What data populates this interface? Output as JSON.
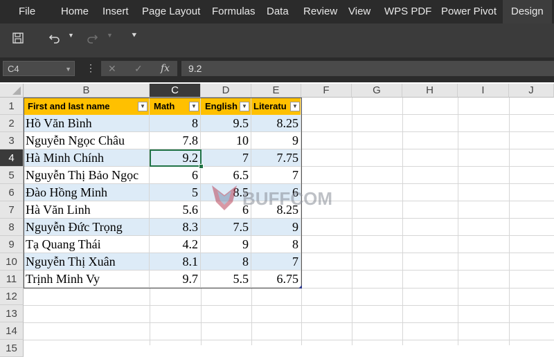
{
  "ribbon": {
    "tabs": [
      "File",
      "Home",
      "Insert",
      "Page Layout",
      "Formulas",
      "Data",
      "Review",
      "View",
      "WPS PDF",
      "Power Pivot",
      "Design"
    ],
    "active_tab": "Design"
  },
  "quick_access": {
    "icons": [
      "save-icon",
      "undo-icon",
      "redo-icon",
      "customize-icon"
    ]
  },
  "formula_bar": {
    "name_box": "C4",
    "fx_label": "fx",
    "value": "9.2"
  },
  "sheet": {
    "columns": [
      "B",
      "C",
      "D",
      "E",
      "F",
      "G",
      "H",
      "I",
      "J"
    ],
    "selected_column": "C",
    "rows": [
      "1",
      "2",
      "3",
      "4",
      "5",
      "6",
      "7",
      "8",
      "9",
      "10",
      "11",
      "12",
      "13",
      "14",
      "15"
    ],
    "selected_row": "4",
    "headers": [
      "First and last name",
      "Math",
      "English",
      "Literatu"
    ],
    "data": [
      {
        "name": "Hồ Văn Bình",
        "math": "8",
        "english": "9.5",
        "lit": "8.25"
      },
      {
        "name": "Nguyễn Ngọc Châu",
        "math": "7.8",
        "english": "10",
        "lit": "9"
      },
      {
        "name": "Hà Minh Chính",
        "math": "9.2",
        "english": "7",
        "lit": "7.75"
      },
      {
        "name": "Nguyễn Thị Bảo Ngọc",
        "math": "6",
        "english": "6.5",
        "lit": "7"
      },
      {
        "name": "Đào Hồng Minh",
        "math": "5",
        "english": "8.5",
        "lit": "6"
      },
      {
        "name": "Hà Văn Linh",
        "math": "5.6",
        "english": "6",
        "lit": "8.25"
      },
      {
        "name": "Nguyễn Đức Trọng",
        "math": "8.3",
        "english": "7.5",
        "lit": "9"
      },
      {
        "name": "Tạ Quang Thái",
        "math": "4.2",
        "english": "9",
        "lit": "8"
      },
      {
        "name": "Nguyễn Thị Xuân",
        "math": "8.1",
        "english": "8",
        "lit": "7"
      },
      {
        "name": "Trịnh Minh Vy",
        "math": "9.7",
        "english": "5.5",
        "lit": "6.75"
      }
    ],
    "header_color": "#ffc000",
    "band_color": "#ddebf7",
    "selection_color": "#217346"
  },
  "watermark": {
    "text": "BUFFCOM"
  }
}
